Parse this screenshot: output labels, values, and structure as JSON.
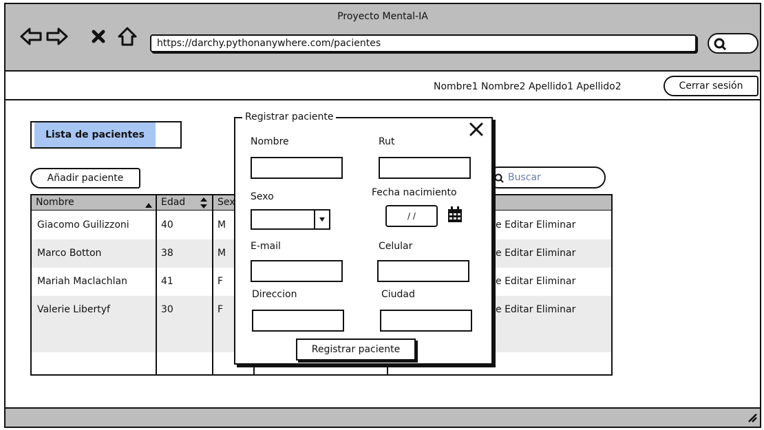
{
  "window": {
    "title": "Proyecto Mental-IA"
  },
  "browser": {
    "url": "https://darchy.pythonanywhere.com/pacientes",
    "icons": [
      "back-icon",
      "forward-icon",
      "stop-icon",
      "home-icon",
      "search-icon"
    ]
  },
  "user": {
    "name": "Nombre1 Nombre2 Apellido1 Apellido2",
    "logout_label": "Cerrar sesión"
  },
  "list": {
    "title": "Lista de pacientes",
    "add_label": "Añadir paciente",
    "search_placeholder": "Buscar"
  },
  "table": {
    "columns": [
      "Nombre",
      "Edad",
      "Sex"
    ],
    "rows": [
      {
        "nombre": "Giacomo Guilizzoni",
        "edad": "40",
        "sexo": "M",
        "actions": "e Editar Eliminar"
      },
      {
        "nombre": "Marco Botton",
        "edad": "38",
        "sexo": "M",
        "actions": "e Editar Eliminar"
      },
      {
        "nombre": "Mariah Maclachlan",
        "edad": "41",
        "sexo": "F",
        "actions": "e Editar Eliminar"
      },
      {
        "nombre": "Valerie Libertyf",
        "edad": "30",
        "sexo": "F",
        "actions": "e Editar Eliminar"
      }
    ]
  },
  "modal": {
    "title": "Registrar paciente",
    "labels": {
      "nombre": "Nombre",
      "rut": "Rut",
      "sexo": "Sexo",
      "fecha": "Fecha nacimiento",
      "email": "E-mail",
      "celular": "Celular",
      "direccion": "Direccion",
      "ciudad": "Ciudad"
    },
    "date_value": "/ /",
    "submit_label": "Registrar paciente"
  },
  "colors": {
    "chrome": "#bdbdbd",
    "accent": "#a8c6f3",
    "row_alt": "#ebebeb",
    "placeholder": "#6b7ea8"
  }
}
